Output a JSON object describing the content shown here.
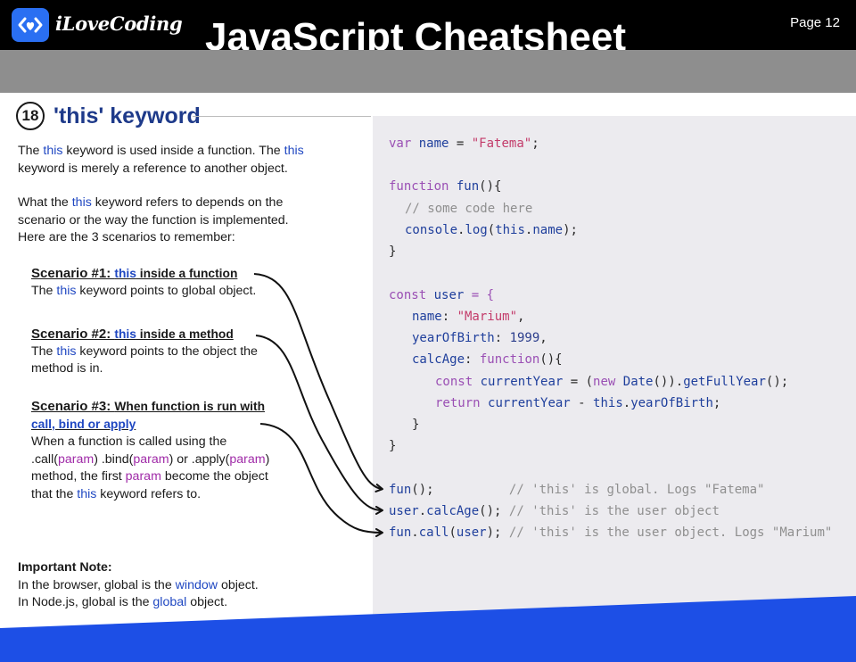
{
  "header": {
    "brand": "iLoveCoding",
    "title": "JavaScript Cheatsheet",
    "page": "Page 12"
  },
  "section": {
    "number": "18",
    "title": "'this' keyword"
  },
  "intro": {
    "p1_a": "The ",
    "p1_k1": "this",
    "p1_b": " keyword is used inside a function. The ",
    "p1_k2": "this",
    "p1_c": "keyword is merely a reference to another object.",
    "p2_a": "What the ",
    "p2_k": "this",
    "p2_b": " keyword refers to depends on the",
    "p2_c": "scenario or the way the function is implemented.",
    "p2_d": "Here are the 3 scenarios to remember:"
  },
  "scenarios": [
    {
      "label": "Scenario #1: ",
      "k": "this",
      "rest": " inside a function",
      "body_a": "The ",
      "body_k": "this",
      "body_b": " keyword points to global object."
    },
    {
      "label": "Scenario #2: ",
      "k": "this",
      "rest": " inside a method",
      "body_a": "The ",
      "body_k": "this",
      "body_b": " keyword points to the object the",
      "body_c": "method is in."
    },
    {
      "label": "Scenario #3: ",
      "rest": "When function is run with",
      "rest2": "call, bind or apply",
      "body_1": "When a function is called using the",
      "body_2a": ".call(",
      "body_2p1": "param",
      "body_2b": ") .bind(",
      "body_2p2": "param",
      "body_2c": ") or .apply(",
      "body_2p3": "param",
      "body_2d": ")",
      "body_3a": "method, the first ",
      "body_3p": "param",
      "body_3b": " become the object",
      "body_4a": "that the ",
      "body_4k": "this",
      "body_4b": " keyword refers to."
    }
  ],
  "note": {
    "title": "Important Note:",
    "l1a": "In the browser, global is the ",
    "l1k": "window",
    "l1b": " object.",
    "l2a": "In Node.js, global is the ",
    "l2k": "global",
    "l2b": " object."
  },
  "code": {
    "l1": [
      "var",
      " ",
      "name",
      " = ",
      "\"Fatema\"",
      ";"
    ],
    "l2": [
      "function",
      " ",
      "fun",
      "(){"
    ],
    "l3": "// some code here",
    "l4": [
      "console",
      ".",
      "log",
      "(",
      "this",
      ".",
      "name",
      ");"
    ],
    "l5": "}",
    "l6": [
      "const",
      " ",
      "user",
      " = {"
    ],
    "l7": [
      "name",
      ": ",
      "\"Marium\"",
      ","
    ],
    "l8": [
      "yearOfBirth",
      ": ",
      "1999",
      ","
    ],
    "l9": [
      "calcAge",
      ": ",
      "function",
      "(){"
    ],
    "l10": [
      "const",
      " ",
      "currentYear",
      " = (",
      "new",
      " ",
      "Date",
      "()).",
      "getFullYear",
      "();"
    ],
    "l11": [
      "return",
      " ",
      "currentYear",
      " - ",
      "this",
      ".",
      "yearOfBirth",
      ";"
    ],
    "l12": "}",
    "l13": "}",
    "l14": [
      "fun",
      "();",
      "          ",
      "// 'this' is global. Logs \"Fatema\""
    ],
    "l15": [
      "user",
      ".",
      "calcAge",
      "();",
      " ",
      "// 'this' is the user object"
    ],
    "l16": [
      "fun",
      ".",
      "call",
      "(",
      "user",
      ");",
      " ",
      "// 'this' is the user object. Logs \"Marium\""
    ]
  },
  "colors": {
    "accent_blue": "#2048c2",
    "keyword_purple": "#a02ba8",
    "footer_blue": "#1d4fe6",
    "code_bg": "#ecebef"
  }
}
